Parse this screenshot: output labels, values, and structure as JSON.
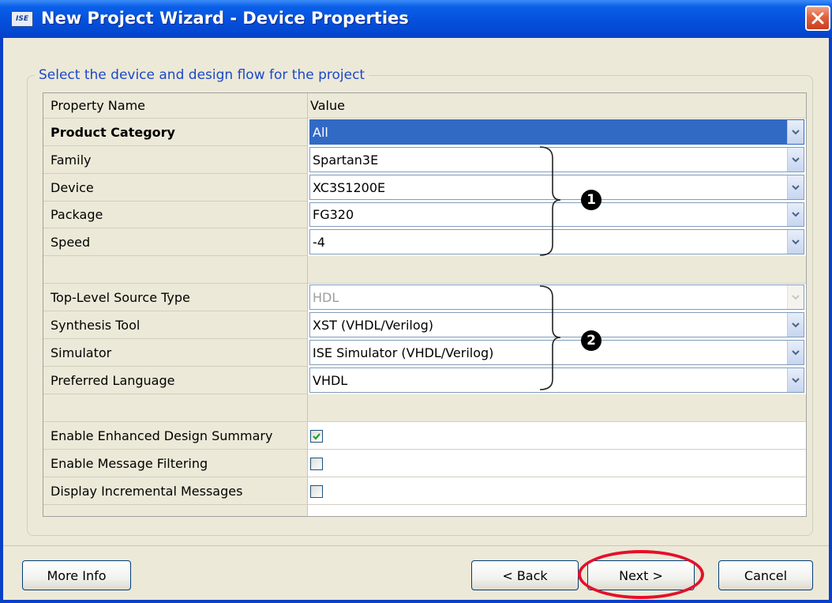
{
  "window": {
    "title": "New Project Wizard - Device Properties",
    "app_icon_text": "ISE"
  },
  "groupbox": {
    "label": "Select the device and design flow for the project"
  },
  "grid": {
    "header": {
      "name": "Property Name",
      "value": "Value"
    },
    "rows": [
      {
        "name": "Product Category",
        "value": "All",
        "bold": true,
        "type": "select",
        "state": "selected"
      },
      {
        "name": "Family",
        "value": "Spartan3E",
        "type": "select"
      },
      {
        "name": "Device",
        "value": "XC3S1200E",
        "type": "select"
      },
      {
        "name": "Package",
        "value": "FG320",
        "type": "select"
      },
      {
        "name": "Speed",
        "value": "-4",
        "type": "select"
      },
      {
        "name": "Top-Level Source Type",
        "value": "HDL",
        "type": "select",
        "state": "disabled"
      },
      {
        "name": "Synthesis Tool",
        "value": "XST (VHDL/Verilog)",
        "type": "select"
      },
      {
        "name": "Simulator",
        "value": "ISE Simulator (VHDL/Verilog)",
        "type": "select"
      },
      {
        "name": "Preferred Language",
        "value": "VHDL",
        "type": "select"
      },
      {
        "name": "Enable Enhanced Design Summary",
        "checked": true,
        "type": "checkbox"
      },
      {
        "name": "Enable Message Filtering",
        "checked": false,
        "type": "checkbox"
      },
      {
        "name": "Display Incremental Messages",
        "checked": false,
        "type": "checkbox"
      }
    ]
  },
  "annotations": {
    "group1": "1",
    "group2": "2"
  },
  "buttons": {
    "more_info": "More Info",
    "back": "< Back",
    "next": "Next >",
    "cancel": "Cancel"
  },
  "colors": {
    "highlight": "#e4102a",
    "title_bar": "#0550dc",
    "selection": "#316ac5"
  }
}
